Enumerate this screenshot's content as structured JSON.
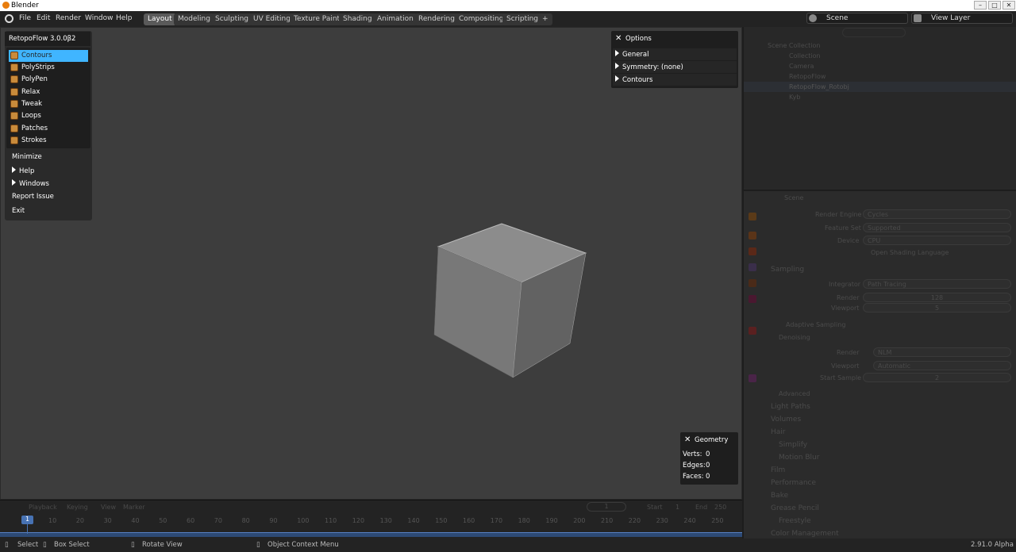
{
  "window": {
    "title": "Blender"
  },
  "menu": [
    "File",
    "Edit",
    "Render",
    "Window",
    "Help"
  ],
  "workspaces": [
    "Layout",
    "Modeling",
    "Sculpting",
    "UV Editing",
    "Texture Paint",
    "Shading",
    "Animation",
    "Rendering",
    "Compositing",
    "Scripting",
    "+"
  ],
  "active_workspace": "Layout",
  "header_right": {
    "scene": "Scene",
    "view_layer": "View Layer"
  },
  "retopoflow": {
    "title": "RetopoFlow 3.0.0β2",
    "tools": [
      "Contours",
      "PolyStrips",
      "PolyPen",
      "Relax",
      "Tweak",
      "Loops",
      "Patches",
      "Strokes"
    ],
    "selected_tool": "Contours",
    "minimize": "Minimize",
    "help": "Help",
    "windows": "Windows",
    "report": "Report Issue",
    "exit": "Exit"
  },
  "options": {
    "title": "Options",
    "rows": [
      "General",
      "Symmetry: (none)",
      "Contours"
    ]
  },
  "geometry": {
    "title": "Geometry",
    "verts": "Verts:",
    "verts_v": "0",
    "edges": "Edges:",
    "edges_v": "0",
    "faces": "Faces:",
    "faces_v": "0"
  },
  "outliner": {
    "root": "Scene Collection",
    "items": [
      "Collection",
      "Camera",
      "RetopoFlow",
      "RetopoFlow_Rotobj",
      "Kyb"
    ]
  },
  "properties": {
    "scene": "Scene",
    "render_engine_l": "Render Engine",
    "render_engine": "Cycles",
    "feature_set_l": "Feature Set",
    "feature_set": "Supported",
    "device_l": "Device",
    "device": "CPU",
    "osl": "Open Shading Language",
    "sampling": "Sampling",
    "integrator_l": "Integrator",
    "integrator": "Path Tracing",
    "render_l": "Render",
    "render": "128",
    "viewport_l": "Viewport",
    "viewport": "5",
    "adaptive": "Adaptive Sampling",
    "denoising": "Denoising",
    "den_render_l": "Render",
    "den_render": "NLM",
    "den_viewport_l": "Viewport",
    "den_viewport": "Automatic",
    "start_sample_l": "Start Sample",
    "start_sample": "2",
    "advanced": "Advanced",
    "sections": [
      "Light Paths",
      "Volumes",
      "Hair",
      "Simplify",
      "Motion Blur",
      "Film",
      "Performance",
      "Bake",
      "Grease Pencil",
      "Freestyle",
      "Color Management"
    ]
  },
  "timeline": {
    "playback": "Playback",
    "keying": "Keying",
    "view": "View",
    "marker": "Marker",
    "current": "1",
    "start_l": "Start",
    "start": "1",
    "end_l": "End",
    "end": "250",
    "frame": "1",
    "ticks": [
      "10",
      "20",
      "30",
      "40",
      "50",
      "60",
      "70",
      "80",
      "90",
      "100",
      "110",
      "120",
      "130",
      "140",
      "150",
      "160",
      "170",
      "180",
      "190",
      "200",
      "210",
      "220",
      "230",
      "240",
      "250"
    ]
  },
  "status": {
    "select": "Select",
    "box": "Box Select",
    "rotate": "Rotate View",
    "ctx": "Object Context Menu",
    "version": "2.91.0 Alpha"
  }
}
